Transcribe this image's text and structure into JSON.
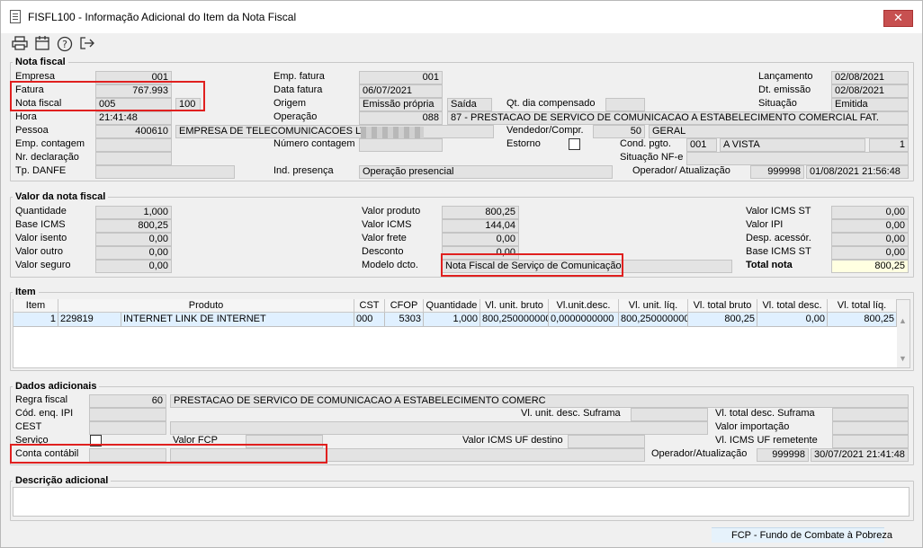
{
  "window": {
    "title": "FISFL100 - Informação Adicional do Item da Nota Fiscal",
    "close_glyph": "✕"
  },
  "toolbar": {
    "icons": [
      "printer-icon",
      "calendar-icon",
      "help-icon",
      "exit-icon"
    ]
  },
  "nota_fiscal": {
    "title": "Nota fiscal",
    "empresa_label": "Empresa",
    "empresa_value": "001",
    "fatura_label": "Fatura",
    "fatura_value": "767.993",
    "nota_fiscal_label": "Nota fiscal",
    "nota_fiscal_value": "005",
    "nota_serie_value": "100",
    "hora_label": "Hora",
    "hora_value": "21:41:48",
    "pessoa_label": "Pessoa",
    "pessoa_code": "400610",
    "pessoa_name": "EMPRESA DE TELECOMUNICACOES LTDA",
    "emp_contagem_label": "Emp. contagem",
    "nr_declaracao_label": "Nr. declaração",
    "tp_danfe_label": "Tp. DANFE",
    "emp_fatura_label": "Emp. fatura",
    "emp_fatura_value": "001",
    "data_fatura_label": "Data fatura",
    "data_fatura_value": "06/07/2021",
    "origem_label": "Origem",
    "origem_value": "Emissão própria",
    "origem_tipo": "Saída",
    "qt_dia_label": "Qt. dia compensado",
    "operacao_label": "Operação",
    "operacao_code": "088",
    "operacao_desc": "87 - PRESTACAO DE SERVICO DE COMUNICACAO A ESTABELECIMENTO COMERCIAL FAT.",
    "vendedor_label": "Vendedor/Compr.",
    "vendedor_code": "50",
    "vendedor_name": "GERAL",
    "numero_contagem_label": "Número contagem",
    "estorno_label": "Estorno",
    "cond_pgto_label": "Cond. pgto.",
    "cond_pgto_code": "001",
    "cond_pgto_desc": "A VISTA",
    "cond_pgto_parc": "1",
    "situacao_nfe_label": "Situação NF-e",
    "ind_presenca_label": "Ind. presença",
    "ind_presenca_value": "Operação presencial",
    "operador_label": "Operador/ Atualização",
    "operador_code": "999998",
    "operador_date": "01/08/2021 21:56:48",
    "lancamento_label": "Lançamento",
    "lancamento_value": "02/08/2021",
    "dt_emissao_label": "Dt. emissão",
    "dt_emissao_value": "02/08/2021",
    "situacao_label": "Situação",
    "situacao_value": "Emitida"
  },
  "valor_nf": {
    "title": "Valor da nota fiscal",
    "quantidade_label": "Quantidade",
    "quantidade_value": "1,000",
    "base_icms_label": "Base ICMS",
    "base_icms_value": "800,25",
    "valor_isento_label": "Valor isento",
    "valor_isento_value": "0,00",
    "valor_outro_label": "Valor outro",
    "valor_outro_value": "0,00",
    "valor_seguro_label": "Valor seguro",
    "valor_seguro_value": "0,00",
    "valor_produto_label": "Valor produto",
    "valor_produto_value": "800,25",
    "valor_icms_label": "Valor ICMS",
    "valor_icms_value": "144,04",
    "valor_frete_label": "Valor frete",
    "valor_frete_value": "0,00",
    "desconto_label": "Desconto",
    "desconto_value": "0,00",
    "modelo_label": "Modelo dcto.",
    "modelo_value": "Nota Fiscal de Serviço de Comunicação",
    "valor_icms_st_label": "Valor ICMS ST",
    "valor_icms_st_value": "0,00",
    "valor_ipi_label": "Valor IPI",
    "valor_ipi_value": "0,00",
    "desp_acessor_label": "Desp. acessór.",
    "desp_acessor_value": "0,00",
    "base_icms_st_label": "Base ICMS ST",
    "base_icms_st_value": "0,00",
    "total_nota_label": "Total nota",
    "total_nota_value": "800,25"
  },
  "item": {
    "title": "Item",
    "headers": [
      "Item",
      "Produto",
      "CST",
      "CFOP",
      "Quantidade",
      "Vl. unit. bruto",
      "Vl.unit.desc.",
      "Vl. unit. líq.",
      "Vl. total bruto",
      "Vl. total desc.",
      "Vl. total líq."
    ],
    "row": {
      "item": "1",
      "produto_code": "229819",
      "produto_desc": "INTERNET LINK DE INTERNET",
      "cst": "000",
      "cfop": "5303",
      "quantidade": "1,000",
      "vl_unit_bruto": "800,2500000000",
      "vl_unit_desc": "0,0000000000",
      "vl_unit_liq": "800,2500000000",
      "vl_total_bruto": "800,25",
      "vl_total_desc": "0,00",
      "vl_total_liq": "800,25"
    }
  },
  "dados_adicionais": {
    "title": "Dados adicionais",
    "regra_fiscal_label": "Regra fiscal",
    "regra_fiscal_code": "60",
    "regra_fiscal_desc": "PRESTACAO DE SERVICO DE COMUNICACAO A ESTABELECIMENTO COMERC",
    "cod_enq_ipi_label": "Cód. enq. IPI",
    "cest_label": "CEST",
    "servico_label": "Serviço",
    "conta_contabil_label": "Conta contábil",
    "valor_fcp_label": "Valor FCP",
    "vl_unit_desc_suframa_label": "Vl. unit. desc. Suframa",
    "valor_icms_uf_destino_label": "Valor ICMS UF destino",
    "vl_total_desc_suframa_label": "Vl. total desc. Suframa",
    "valor_importacao_label": "Valor importação",
    "vl_icms_uf_remetente_label": "Vl. ICMS UF remetente",
    "operador_label": "Operador/Atualização",
    "operador_code": "999998",
    "operador_date": "30/07/2021 21:41:48"
  },
  "descricao": {
    "title": "Descrição adicional",
    "value": ""
  },
  "status": {
    "text": "FCP - Fundo de Combate à Pobreza"
  }
}
